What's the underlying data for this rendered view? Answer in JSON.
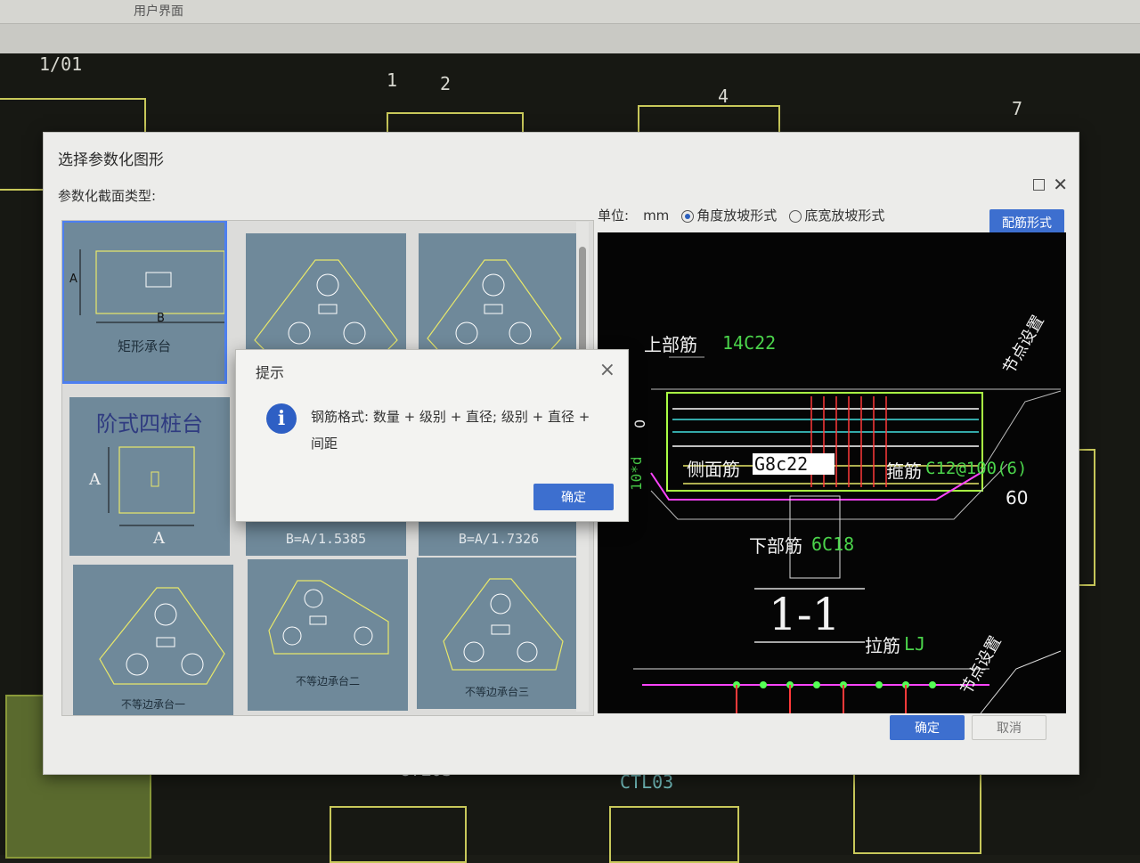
{
  "app": {
    "tab_label": "用户界面"
  },
  "cad_background": {
    "axis_numbers": [
      "1/01",
      "1",
      "2",
      "4",
      "7"
    ],
    "labels": [
      "CTL03",
      "CTL03"
    ]
  },
  "dialog": {
    "title": "选择参数化图形",
    "section_label": "参数化截面类型:",
    "unit_label": "单位:",
    "unit_value": "mm",
    "radio_options": [
      {
        "label": "角度放坡形式",
        "checked": true
      },
      {
        "label": "底宽放坡形式",
        "checked": false
      }
    ],
    "config_button": "配筋形式",
    "ok_button": "确定",
    "cancel_button": "取消",
    "tiles": [
      {
        "caption": "矩形承台",
        "selected": true,
        "dims": [
          "A",
          "B"
        ]
      },
      {
        "caption": "",
        "selected": false
      },
      {
        "caption": "",
        "selected": false
      },
      {
        "caption": "阶式四桩台",
        "selected": false,
        "dims": [
          "A",
          "A"
        ]
      },
      {
        "caption": "B=A/1.5385",
        "selected": false
      },
      {
        "caption": "B=A/1.7326",
        "selected": false
      },
      {
        "caption": "不等边承台一",
        "selected": false
      },
      {
        "caption": "不等边承台二",
        "selected": false
      },
      {
        "caption": "不等边承台三",
        "selected": false
      }
    ]
  },
  "preview": {
    "top_bar_label": "上部筋",
    "top_bar_value": "14C22",
    "side_bar_label": "侧面筋",
    "side_bar_value": "G8c22",
    "stirrup_label": "箍筋",
    "stirrup_value": "C12@100(6)",
    "bottom_bar_label": "下部筋",
    "bottom_bar_value": "6C18",
    "section_mark": "1-1",
    "tie_label": "拉筋",
    "tie_value": "LJ",
    "node_setting": "节点设置",
    "dim_60": "60",
    "dim_0": "0",
    "dim_10d": "10*d"
  },
  "tip": {
    "title": "提示",
    "message": "钢筋格式: 数量 + 级别 + 直径; 级别 + 直径 + 间距",
    "ok_button": "确定"
  }
}
